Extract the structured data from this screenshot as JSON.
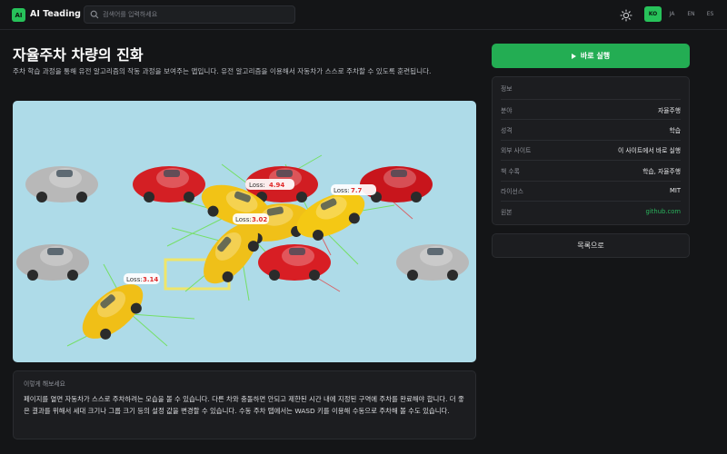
{
  "header": {
    "logo": "AI",
    "brand": "AI Teading",
    "search_placeholder": "검색어를 입력하세요",
    "languages": [
      {
        "code": "KO",
        "active": true
      },
      {
        "code": "JA",
        "active": false
      },
      {
        "code": "EN",
        "active": false
      },
      {
        "code": "ES",
        "active": false
      }
    ]
  },
  "main": {
    "title": "자율주차 차량의 진화",
    "description": "주차 학습 과정을 통해 유전 알고리즘의 작동 과정을 보여주는 앱입니다. 유전 알고리즘을 이용해서 자동차가 스스로 주차할 수 있도록 훈련됩니다.",
    "loss_labels": [
      {
        "prefix": "Loss:",
        "value": "4.94"
      },
      {
        "prefix": "Loss:",
        "value": "7.7"
      },
      {
        "prefix": "Loss:",
        "value": "3.02"
      },
      {
        "prefix": "Loss:",
        "value": "3.14"
      }
    ],
    "howto_title": "이렇게 해보세요",
    "howto_body": "페이지를 열면 자동차가 스스로 주차하려는 모습을 볼 수 있습니다. 다른 차와 충돌하면 안되고 제한된 시간 내에 지정된 구역에 주차를 완료해야 합니다. 더 좋은 결과를 위해서 세대 크기나 그룹 크기 등의 설정 값을 변경할 수 있습니다. 수동 주차 탭에서는 WASD 키를 이용해 수동으로 주차해 볼 수도 있습니다."
  },
  "sidebar": {
    "run_label": "바로 실행",
    "info_title": "정보",
    "rows": [
      {
        "key": "분야",
        "value": "자율주행"
      },
      {
        "key": "성격",
        "value": "학습"
      },
      {
        "key": "외부 사이트",
        "value": "이 사이트에서 바로 실행"
      },
      {
        "key": "책 수록",
        "value": "학습, 자율주행"
      },
      {
        "key": "라이선스",
        "value": "MIT"
      },
      {
        "key": "원본",
        "value": "github.com"
      }
    ],
    "list_label": "목록으로"
  },
  "colors": {
    "accent": "#27c25a",
    "background": "#141517",
    "panel": "#1c1d20",
    "canvas": "#aedbe8"
  }
}
